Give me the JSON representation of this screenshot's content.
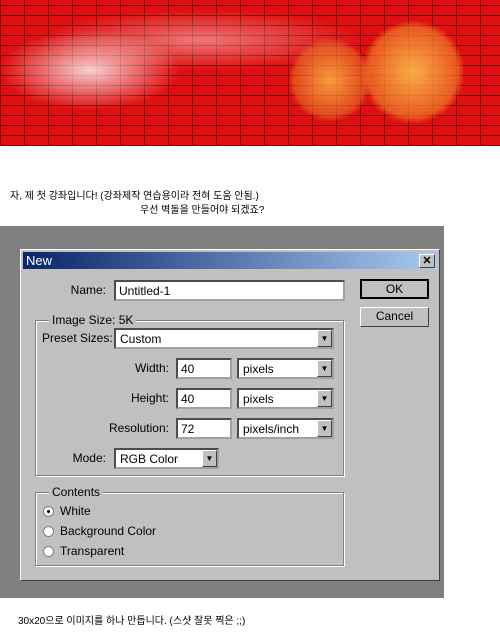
{
  "captions": {
    "line1": "자, 제 첫 강좌입니다! (강좌제작 연습용이라 전혀 도움 안됨.)",
    "line2": "우선 벽돌을 만들어야 되겠죠?",
    "bottom": "30x20으로 이미지를 하나 만듭니다. (스샷 잘못 찍은 ;;)"
  },
  "dialog": {
    "title": "New",
    "close_glyph": "✕",
    "name_label": "Name:",
    "name_value": "Untitled-1",
    "ok_label": "OK",
    "cancel_label": "Cancel",
    "image_size_legend": "Image Size: 5K",
    "preset_label": "Preset Sizes:",
    "preset_value": "Custom",
    "width_label": "Width:",
    "width_value": "40",
    "width_unit": "pixels",
    "height_label": "Height:",
    "height_value": "40",
    "height_unit": "pixels",
    "resolution_label": "Resolution:",
    "resolution_value": "72",
    "resolution_unit": "pixels/inch",
    "mode_label": "Mode:",
    "mode_value": "RGB Color",
    "contents_legend": "Contents",
    "contents_options": [
      {
        "label": "White",
        "selected": true
      },
      {
        "label": "Background Color",
        "selected": false
      },
      {
        "label": "Transparent",
        "selected": false
      }
    ],
    "arrow_glyph": "▼"
  },
  "colors": {
    "title_start": "#0a246a",
    "title_end": "#a6caf0",
    "dialog_bg": "#c0c0c0",
    "brick": "#e01010"
  }
}
